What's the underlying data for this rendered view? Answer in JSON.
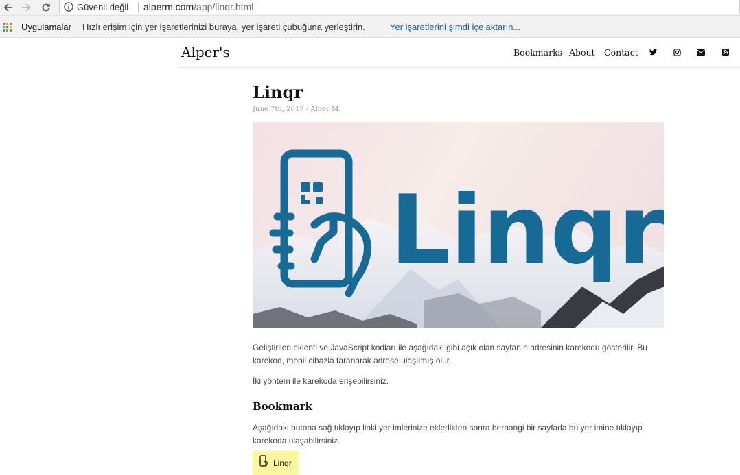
{
  "browser": {
    "security_label": "Güvenli değil",
    "url_domain": "alperm.com",
    "url_path": "/app/linqr.html",
    "bookmarks_bar": {
      "apps_label": "Uygulamalar",
      "hint": "Hızlı erişim için yer işaretlerinizi buraya, yer işareti çubuğuna yerleştirin.",
      "import_link": "Yer işaretlerini şimdi içe aktarın..."
    }
  },
  "site": {
    "brand": "Alper's",
    "nav": [
      "Bookmarks",
      "About",
      "Contact"
    ],
    "social_icons": [
      "twitter-icon",
      "instagram-icon",
      "email-icon",
      "rss-icon"
    ]
  },
  "post": {
    "title": "Linqr",
    "meta": "June 7th, 2017 - Alper M.",
    "hero_text": "Linqr",
    "paragraph1": "Geliştirilen eklenti ve JavaScript kodları ile aşağıdaki gibi açık olan sayfanın adresinin karekodu gösterilir. Bu karekod, mobil cihazla taranarak adrese ulaşılmış olur.",
    "paragraph2": "İki yöntem ile karekoda erişebilirsiniz.",
    "section_heading": "Bookmark",
    "paragraph3": "Aşağıdaki butona sağ tıklayıp linki yer imlerinize ekledikten sonra herhangi bir sayfada bu yer imine tıklayıp karekoda ulaşabilirsiniz.",
    "bookmark_button": "Linqr"
  },
  "colors": {
    "brand_blue": "#176a96",
    "link_blue": "#1a5fb4",
    "button_yellow": "#fbf7a0"
  }
}
